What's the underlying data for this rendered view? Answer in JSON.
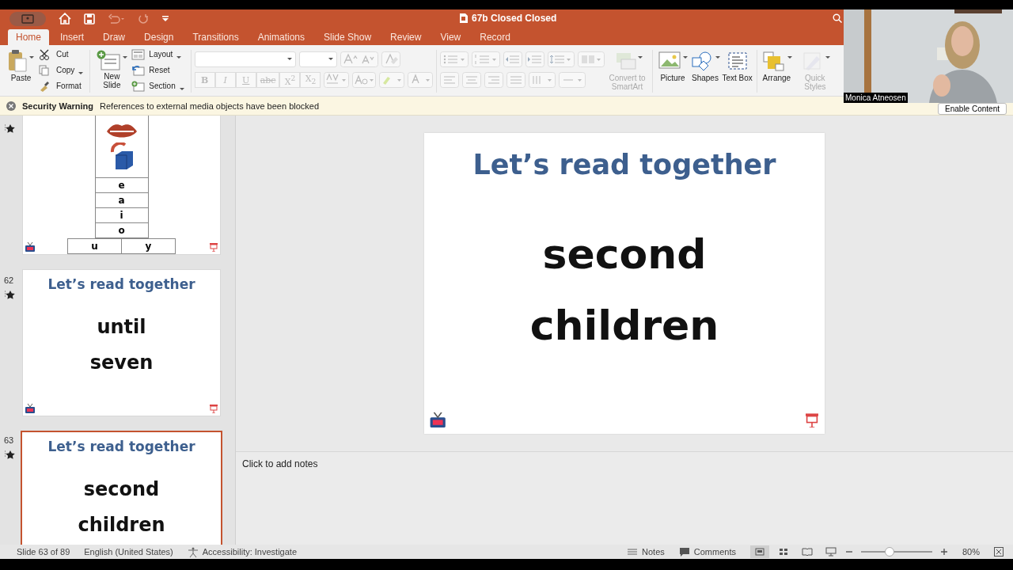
{
  "window": {
    "title": "67b Closed Closed"
  },
  "tabs": [
    {
      "label": "Home",
      "selected": true
    },
    {
      "label": "Insert",
      "selected": false
    },
    {
      "label": "Draw",
      "selected": false
    },
    {
      "label": "Design",
      "selected": false
    },
    {
      "label": "Transitions",
      "selected": false
    },
    {
      "label": "Animations",
      "selected": false
    },
    {
      "label": "Slide Show",
      "selected": false
    },
    {
      "label": "Review",
      "selected": false
    },
    {
      "label": "View",
      "selected": false
    },
    {
      "label": "Record",
      "selected": false
    }
  ],
  "ribbon": {
    "paste": {
      "label": "Paste"
    },
    "clipboard_items": [
      {
        "kind": "cut",
        "label": "Cut",
        "has_menu": false
      },
      {
        "kind": "copy",
        "label": "Copy",
        "has_menu": true
      },
      {
        "kind": "format",
        "label": "Format",
        "has_menu": false
      }
    ],
    "new_slide": {
      "label": "New Slide"
    },
    "slide_items": [
      {
        "kind": "layout",
        "label": "Layout",
        "has_menu": true
      },
      {
        "kind": "reset",
        "label": "Reset",
        "has_menu": false
      },
      {
        "kind": "section",
        "label": "Section",
        "has_menu": true
      }
    ],
    "font_buttons": [
      {
        "label": "B",
        "disabled": true
      },
      {
        "label": "I",
        "disabled": true
      },
      {
        "label": "U",
        "disabled": true
      },
      {
        "label": "abc",
        "disabled": true
      },
      {
        "label": "X$^{2}$",
        "disabled": true
      },
      {
        "label": "X$_{2}$",
        "disabled": true
      }
    ],
    "insert_buttons": [
      {
        "kind": "smartart",
        "label": "Convert to SmartArt",
        "disabled": true
      },
      {
        "kind": "picture",
        "label": "Picture",
        "disabled": false
      },
      {
        "kind": "shapes",
        "label": "Shapes",
        "disabled": false
      },
      {
        "kind": "textbox",
        "label": "Text Box",
        "disabled": false
      },
      {
        "kind": "arrange",
        "label": "Arrange",
        "disabled": false
      },
      {
        "kind": "styles",
        "label": "Quick Styles",
        "disabled": true
      }
    ]
  },
  "security_bar": {
    "title": "Security Warning",
    "message": "References to external media objects have been blocked",
    "button": "Enable Content"
  },
  "video_overlay": {
    "kind": "picture",
    "name": "Monica Atneosen"
  },
  "thumbnails": [
    {
      "kind": "vowel_chart",
      "selected": false,
      "letters": [
        "e",
        "a",
        "i",
        "o"
      ],
      "bottom_letters": [
        "u",
        "y"
      ]
    },
    {
      "kind": "words",
      "number": "62",
      "selected": false,
      "title": "Let’s read together",
      "words": [
        "until",
        "seven"
      ]
    },
    {
      "kind": "words",
      "number": "63",
      "selected": true,
      "title": "Let’s read together",
      "words": [
        "second",
        "children"
      ]
    }
  ],
  "slide": {
    "title": "Let’s read together",
    "words": [
      "second",
      "children"
    ]
  },
  "notes": {
    "placeholder": "Click to add notes"
  },
  "status_bar": {
    "slide_info": "Slide 63 of 89",
    "language": "English (United States)",
    "accessibility": "Accessibility: Investigate",
    "notes": "Notes",
    "comments": "Comments",
    "views": [
      {
        "kind": "normal",
        "selected": true
      },
      {
        "kind": "sorter",
        "selected": false
      },
      {
        "kind": "reading",
        "selected": false
      },
      {
        "kind": "show",
        "selected": false
      }
    ],
    "zoom": {
      "level": 0.4,
      "reading": "80%"
    }
  }
}
